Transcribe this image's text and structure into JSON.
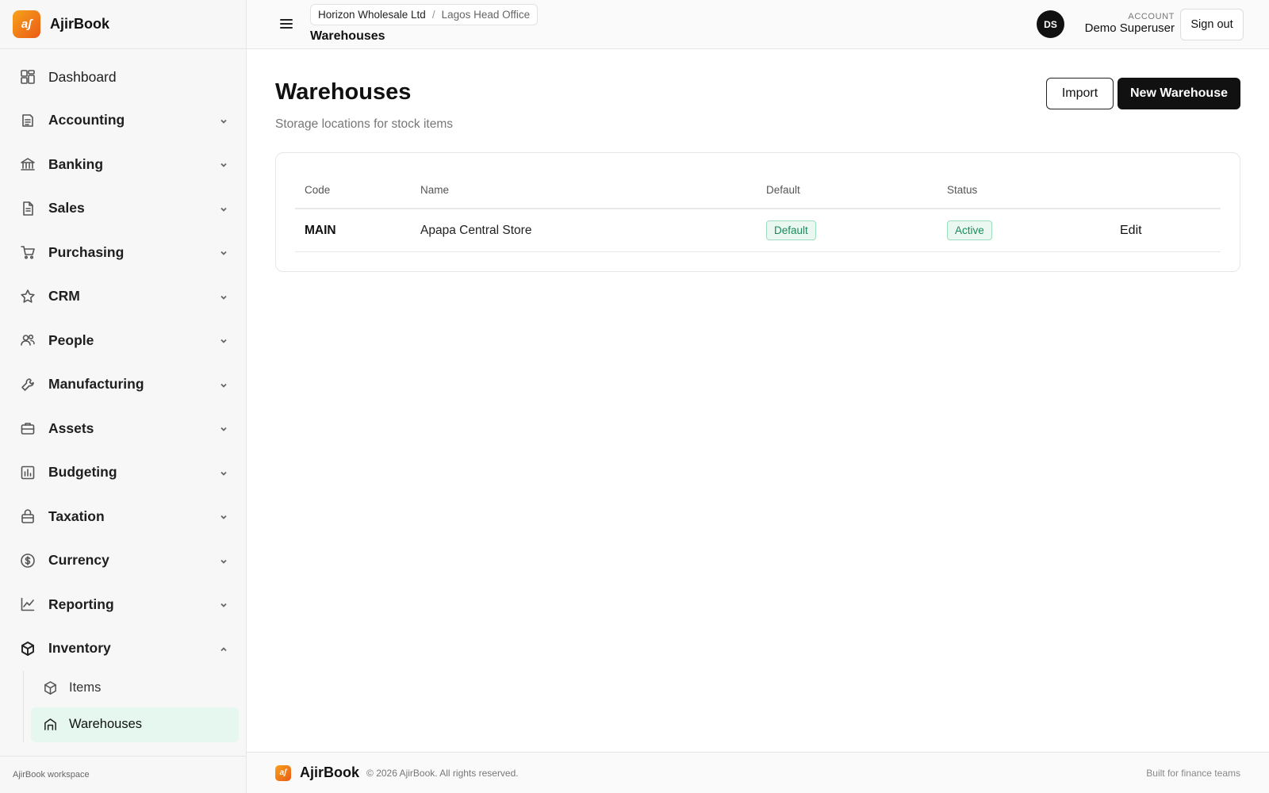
{
  "brand": {
    "name": "AjirBook",
    "logo_text": "aʃ"
  },
  "sidebar": {
    "items": [
      {
        "label": "Dashboard",
        "icon": "dashboard-icon",
        "has_chevron": false
      },
      {
        "label": "Accounting",
        "icon": "ledger-icon",
        "has_chevron": true
      },
      {
        "label": "Banking",
        "icon": "bank-icon",
        "has_chevron": true
      },
      {
        "label": "Sales",
        "icon": "invoice-icon",
        "has_chevron": true
      },
      {
        "label": "Purchasing",
        "icon": "cart-icon",
        "has_chevron": true
      },
      {
        "label": "CRM",
        "icon": "star-icon",
        "has_chevron": true
      },
      {
        "label": "People",
        "icon": "people-icon",
        "has_chevron": true
      },
      {
        "label": "Manufacturing",
        "icon": "wrench-icon",
        "has_chevron": true
      },
      {
        "label": "Assets",
        "icon": "briefcase-icon",
        "has_chevron": true
      },
      {
        "label": "Budgeting",
        "icon": "bar-chart-icon",
        "has_chevron": true
      },
      {
        "label": "Taxation",
        "icon": "lock-box-icon",
        "has_chevron": true
      },
      {
        "label": "Currency",
        "icon": "coin-icon",
        "has_chevron": true
      },
      {
        "label": "Reporting",
        "icon": "line-chart-icon",
        "has_chevron": true
      },
      {
        "label": "Inventory",
        "icon": "cube-icon",
        "has_chevron": true,
        "expanded": true
      }
    ],
    "inventory_sub": [
      {
        "label": "Items",
        "icon": "cube-icon",
        "active": false
      },
      {
        "label": "Warehouses",
        "icon": "warehouse-icon",
        "active": true
      }
    ],
    "footer_text": "AjirBook workspace"
  },
  "topbar": {
    "org": "Horizon Wholesale Ltd",
    "separator": "/",
    "branch": "Lagos Head Office",
    "title": "Warehouses",
    "avatar_initials": "DS",
    "account_label": "ACCOUNT",
    "account_name": "Demo Superuser",
    "signout_label": "Sign out"
  },
  "page": {
    "title": "Warehouses",
    "subtitle": "Storage locations for stock items",
    "import_label": "Import",
    "new_label": "New Warehouse"
  },
  "table": {
    "headers": [
      "Code",
      "Name",
      "Default",
      "Status"
    ],
    "rows": [
      {
        "code": "MAIN",
        "name": "Apapa Central Store",
        "default": "Default",
        "status": "Active",
        "action": "Edit"
      }
    ]
  },
  "footer": {
    "brand": "AjirBook",
    "copyright": "© 2026 AjirBook. All rights reserved.",
    "right": "Built for finance teams"
  },
  "colors": {
    "accent_orange": "#f08a1c",
    "primary_dark": "#111111",
    "badge_green": "#1a8a5a",
    "active_bg": "#e6f7ef"
  }
}
